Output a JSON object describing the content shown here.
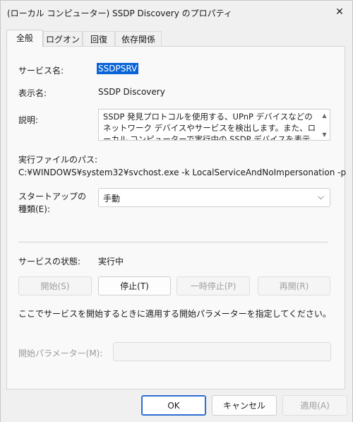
{
  "window": {
    "title": "(ローカル コンピューター) SSDP Discovery のプロパティ"
  },
  "tabs": [
    {
      "label": "全般"
    },
    {
      "label": "ログオン"
    },
    {
      "label": "回復"
    },
    {
      "label": "依存関係"
    }
  ],
  "general": {
    "service_name_label": "サービス名:",
    "service_name_value": "SSDPSRV",
    "display_name_label": "表示名:",
    "display_name_value": "SSDP Discovery",
    "description_label": "説明:",
    "description_value": "SSDP 発見プロトコルを使用する、UPnP デバイスなどのネットワーク デバイスやサービスを検出します。また、ローカル コンピューターで実行中の SSDP デバイスを表示します。サービスを停止すると、",
    "exe_path_label": "実行ファイルのパス:",
    "exe_path_value": "C:¥WINDOWS¥system32¥svchost.exe -k LocalServiceAndNoImpersonation -p",
    "startup_label_line1": "スタートアップの",
    "startup_label_line2": "種類(E):",
    "startup_value": "手動",
    "status_label": "サービスの状態:",
    "status_value": "実行中",
    "buttons": {
      "start": "開始(S)",
      "stop": "停止(T)",
      "pause": "一時停止(P)",
      "resume": "再開(R)"
    },
    "hint": "ここでサービスを開始するときに適用する開始パラメーターを指定してください。",
    "params_label": "開始パラメーター(M):",
    "params_value": ""
  },
  "footer": {
    "ok": "OK",
    "cancel": "キャンセル",
    "apply": "適用(A)"
  },
  "icons": {
    "close": "close-icon",
    "dropdown": "chevron-down-icon"
  }
}
